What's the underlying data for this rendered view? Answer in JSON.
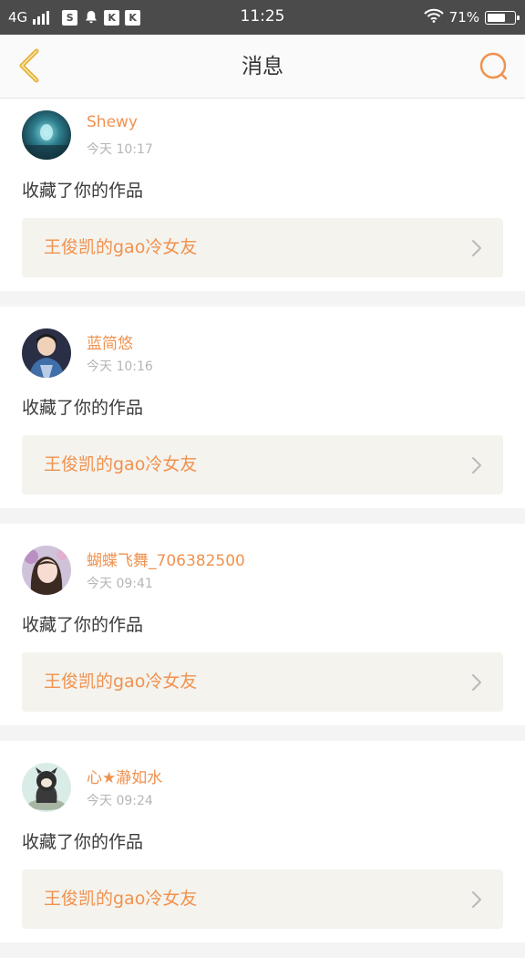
{
  "status_bar": {
    "network": "4G",
    "signal_icon": "signal-bars-icon",
    "apps": [
      "S",
      "bell",
      "K",
      "K"
    ],
    "time": "11:25",
    "wifi_icon": "wifi-icon",
    "battery_text": "71%",
    "battery_level": 0.71
  },
  "nav": {
    "back_icon": "chevron-left-icon",
    "title": "消息",
    "search_icon": "search-icon",
    "accent_color": "#f0924f",
    "back_color": "#e3b23b"
  },
  "messages": [
    {
      "user": "Shewy",
      "time": "今天 10:17",
      "action": "收藏了你的作品",
      "work_title": "王俊凯的gao冷女友"
    },
    {
      "user": "蓝简悠",
      "time": "今天 10:16",
      "action": "收藏了你的作品",
      "work_title": "王俊凯的gao冷女友"
    },
    {
      "user": "蝴蝶飞舞_706382500",
      "time": "今天 09:41",
      "action": "收藏了你的作品",
      "work_title": "王俊凯的gao冷女友"
    },
    {
      "user": "心★瀞如水",
      "time": "今天 09:24",
      "action": "收藏了你的作品",
      "work_title": "王俊凯的gao冷女友"
    }
  ]
}
